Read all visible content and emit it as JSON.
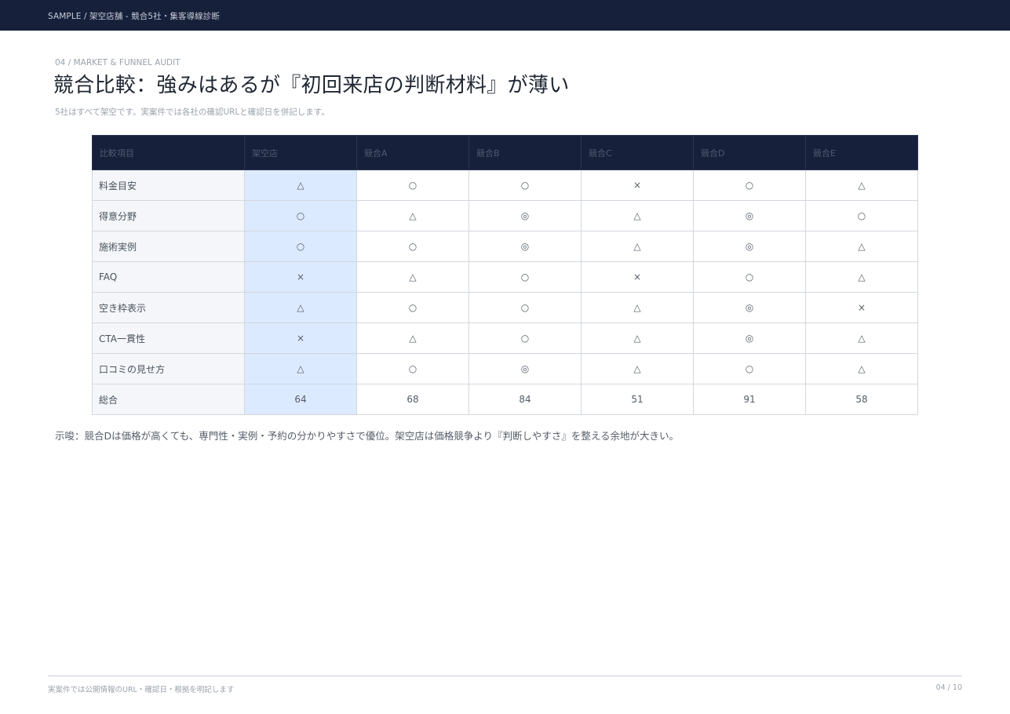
{
  "header": {
    "breadcrumb": "SAMPLE / 架空店舗 - 競合5社・集客導線診断"
  },
  "section": {
    "eyebrow": "04 / MARKET & FUNNEL AUDIT"
  },
  "page": {
    "title": "競合比較：強みはあるが『初回来店の判断材料』が薄い",
    "subtitle": "5社はすべて架空です。実案件では各社の確認URLと確認日を併記します。"
  },
  "table": {
    "headers": [
      "比較項目",
      "架空店",
      "競合A",
      "競合B",
      "競合C",
      "競合D",
      "競合E"
    ],
    "rows": [
      {
        "label": "料金目安",
        "values": [
          "△",
          "○",
          "○",
          "×",
          "○",
          "△"
        ]
      },
      {
        "label": "得意分野",
        "values": [
          "○",
          "△",
          "◎",
          "△",
          "◎",
          "○"
        ]
      },
      {
        "label": "施術実例",
        "values": [
          "○",
          "○",
          "◎",
          "△",
          "◎",
          "△"
        ]
      },
      {
        "label": "FAQ",
        "values": [
          "×",
          "△",
          "○",
          "×",
          "○",
          "△"
        ]
      },
      {
        "label": "空き枠表示",
        "values": [
          "△",
          "○",
          "○",
          "△",
          "◎",
          "×"
        ]
      },
      {
        "label": "CTA一貫性",
        "values": [
          "×",
          "△",
          "○",
          "△",
          "◎",
          "△"
        ]
      },
      {
        "label": "口コミの見せ方",
        "values": [
          "△",
          "○",
          "◎",
          "△",
          "○",
          "△"
        ]
      },
      {
        "label": "総合",
        "values": [
          "64",
          "68",
          "84",
          "51",
          "91",
          "58"
        ]
      }
    ]
  },
  "insight": "示唆：競合Dは価格が高くても、専門性・実例・予約の分かりやすさで優位。架空店は価格競争より『判断しやすさ』を整える余地が大きい。",
  "footer": {
    "note": "実案件では公開情報のURL・確認日・根拠を明記します",
    "page_number": "04 / 10"
  },
  "colors": {
    "header_bg": "#16203a",
    "highlight_column": "#dceaff",
    "label_column": "#f4f6f9"
  }
}
